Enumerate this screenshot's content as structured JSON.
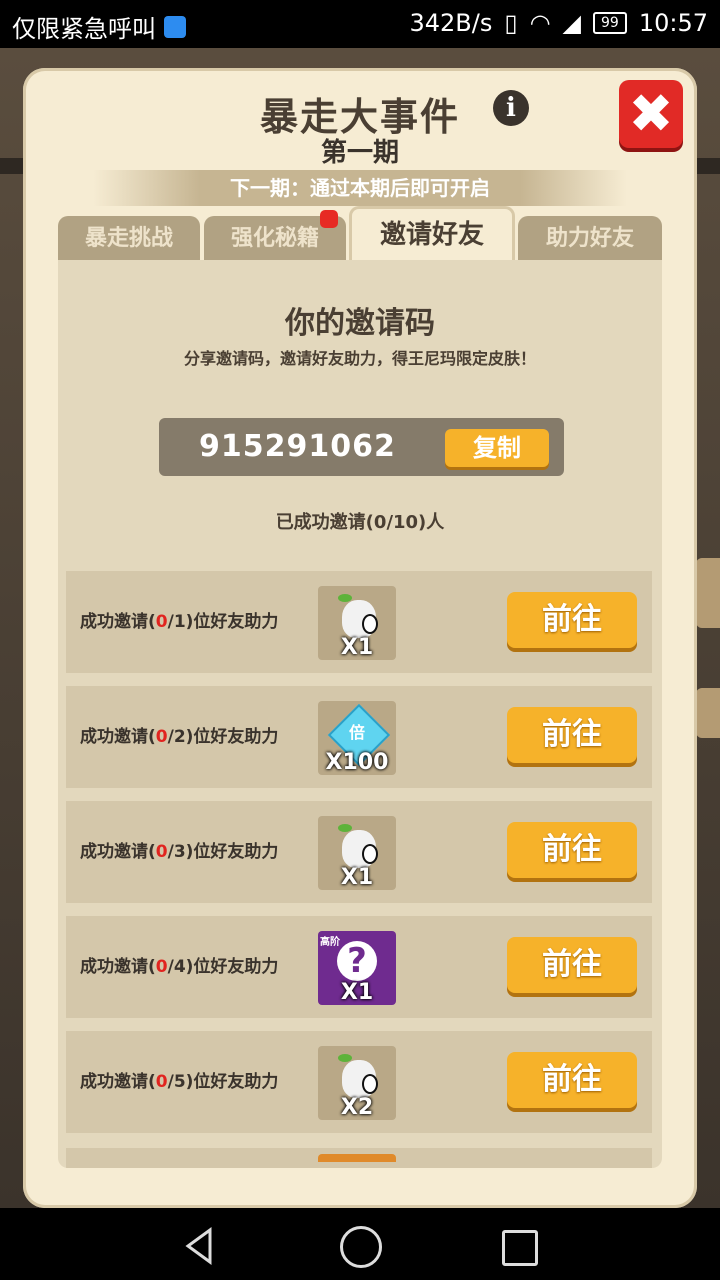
{
  "status_bar": {
    "carrier_text": "仅限紧急呼叫",
    "net_speed": "342B/s",
    "battery": "99",
    "time": "10:57"
  },
  "modal": {
    "title": "暴走大事件",
    "subtitle": "第一期",
    "next_banner": "下一期：通过本期后即可开启",
    "tabs": [
      {
        "label": "暴走挑战",
        "active": false
      },
      {
        "label": "强化秘籍",
        "active": false,
        "badge": true
      },
      {
        "label": "邀请好友",
        "active": true
      },
      {
        "label": "助力好友",
        "active": false
      }
    ],
    "invite": {
      "heading": "你的邀请码",
      "description": "分享邀请码，邀请好友助力，得王尼玛限定皮肤！",
      "code": "915291062",
      "copy_label": "复制",
      "success_count": "已成功邀请(0/10)人"
    },
    "rows": [
      {
        "prefix": "成功邀请(",
        "current": "0",
        "suffix": "/1)位好友助力",
        "reward_icon": "ghost-fragment-icon",
        "reward_qty": "X1",
        "button": "前往"
      },
      {
        "prefix": "成功邀请(",
        "current": "0",
        "suffix": "/2)位好友助力",
        "reward_icon": "diamond-gem-icon",
        "reward_label": "倍",
        "reward_qty": "X100",
        "button": "前往"
      },
      {
        "prefix": "成功邀请(",
        "current": "0",
        "suffix": "/3)位好友助力",
        "reward_icon": "ghost-fragment-icon",
        "reward_qty": "X1",
        "button": "前往"
      },
      {
        "prefix": "成功邀请(",
        "current": "0",
        "suffix": "/4)位好友助力",
        "reward_icon": "mystery-box-icon",
        "reward_label": "高阶",
        "reward_qty": "X1",
        "button": "前往"
      },
      {
        "prefix": "成功邀请(",
        "current": "0",
        "suffix": "/5)位好友助力",
        "reward_icon": "ghost-fragment-icon",
        "reward_qty": "X2",
        "button": "前往"
      }
    ]
  },
  "colors": {
    "accent_orange": "#f6b22a",
    "close_red": "#e12a26",
    "highlight_red": "#e1241f",
    "panel_beige": "#f6ecd3"
  }
}
